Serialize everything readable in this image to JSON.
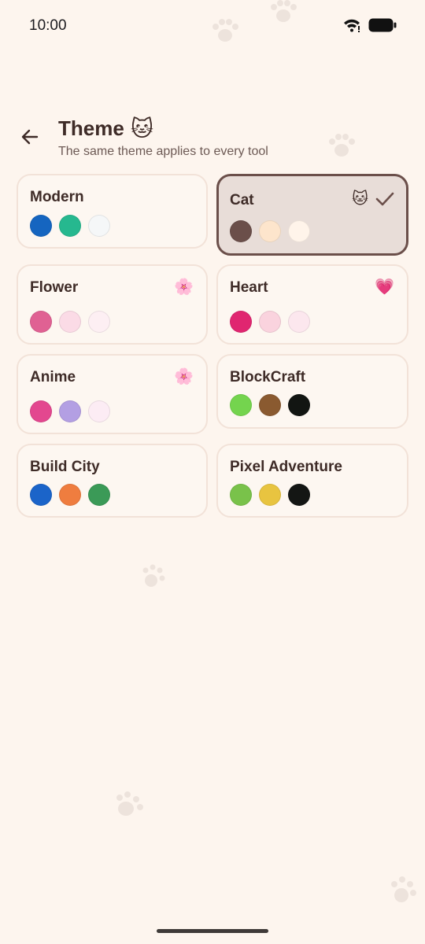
{
  "status_bar": {
    "time": "10:00"
  },
  "header": {
    "title": "Theme",
    "title_emoji": "🐱",
    "subtitle": "The same theme applies to every tool"
  },
  "themes": [
    {
      "name": "Modern",
      "emoji": "",
      "selected": false,
      "colors": [
        "#1565c0",
        "#26b88f",
        "#f5f7f8"
      ]
    },
    {
      "name": "Cat",
      "emoji": "🐱",
      "selected": true,
      "colors": [
        "#6b4f4a",
        "#fde5cc",
        "#fff4ea"
      ]
    },
    {
      "name": "Flower",
      "emoji": "🌸",
      "selected": false,
      "colors": [
        "#e06193",
        "#fbdbe6",
        "#fdeff3"
      ]
    },
    {
      "name": "Heart",
      "emoji": "💗",
      "selected": false,
      "colors": [
        "#e02670",
        "#fad3de",
        "#fce7ee"
      ]
    },
    {
      "name": "Anime",
      "emoji": "🌸",
      "selected": false,
      "colors": [
        "#e3478f",
        "#b39fe3",
        "#fcecf4"
      ]
    },
    {
      "name": "BlockCraft",
      "emoji": "",
      "selected": false,
      "colors": [
        "#74d44e",
        "#8a5a30",
        "#121512"
      ]
    },
    {
      "name": "Build City",
      "emoji": "",
      "selected": false,
      "colors": [
        "#1b64c9",
        "#ef7d3f",
        "#3b9a57"
      ]
    },
    {
      "name": "Pixel Adventure",
      "emoji": "",
      "selected": false,
      "colors": [
        "#79c24a",
        "#e8c440",
        "#141614"
      ]
    }
  ],
  "colors": {
    "background": "#fdf5ee",
    "accent": "#6b4f4a",
    "card_border": "#f2e2d8"
  }
}
